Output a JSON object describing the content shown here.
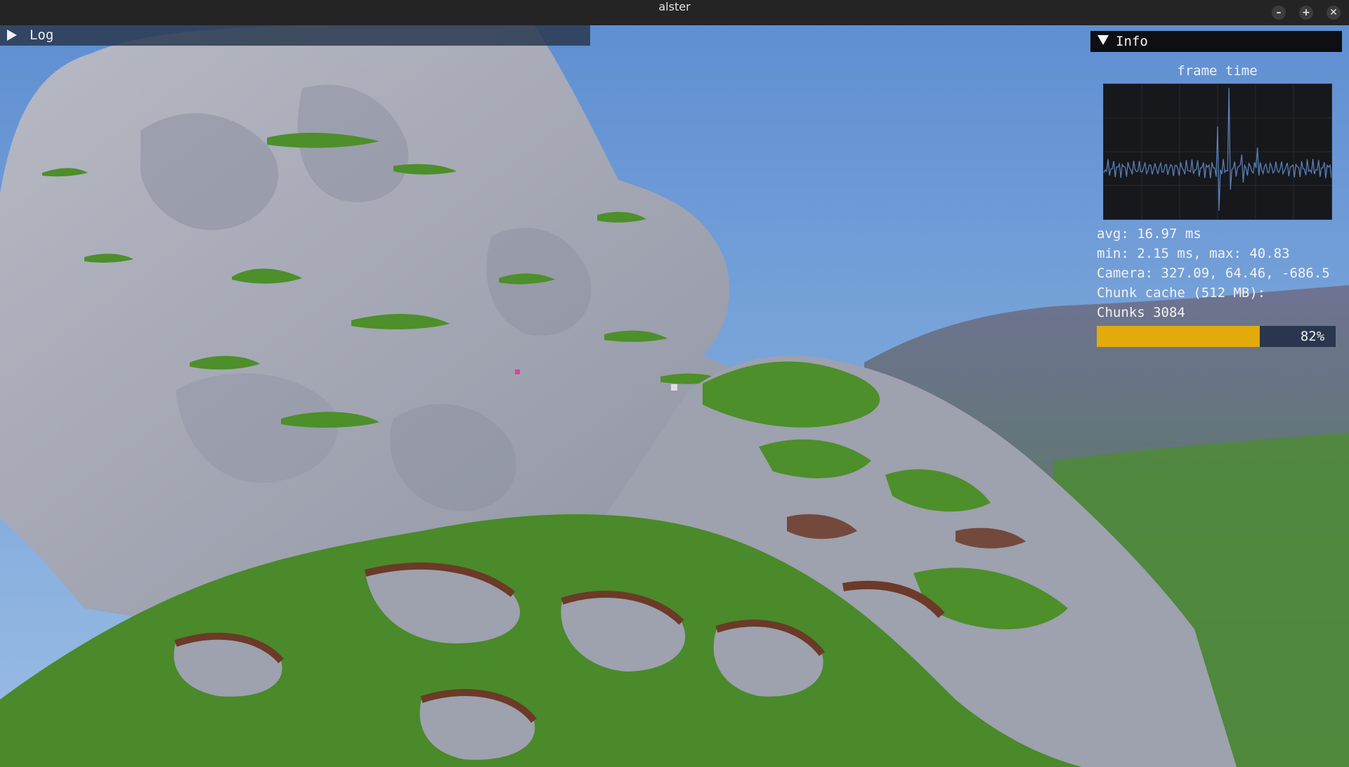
{
  "window": {
    "title": "alster",
    "buttons": [
      "–",
      "+",
      "✕"
    ]
  },
  "log_panel": {
    "label": "Log",
    "expanded": false
  },
  "info_panel": {
    "label": "Info",
    "expanded": true,
    "plot_title": "frame time",
    "avg": "avg: 16.97 ms",
    "minmax": "min: 2.15 ms, max: 40.83",
    "camera": "Camera: 327.09, 64.46, -686.5",
    "chunk_cache": "Chunk cache (512 MB):",
    "chunks": "Chunks 3084",
    "progress_label": "82%",
    "progress_fraction": 0.82
  },
  "colors": {
    "sky": "#6a9ad6",
    "rock": "#a9abb6",
    "grass": "#4d8f2a",
    "dirt": "#6b3a28",
    "progress_fill": "#e2aa0a",
    "plot_line": "#5b7fb4"
  }
}
